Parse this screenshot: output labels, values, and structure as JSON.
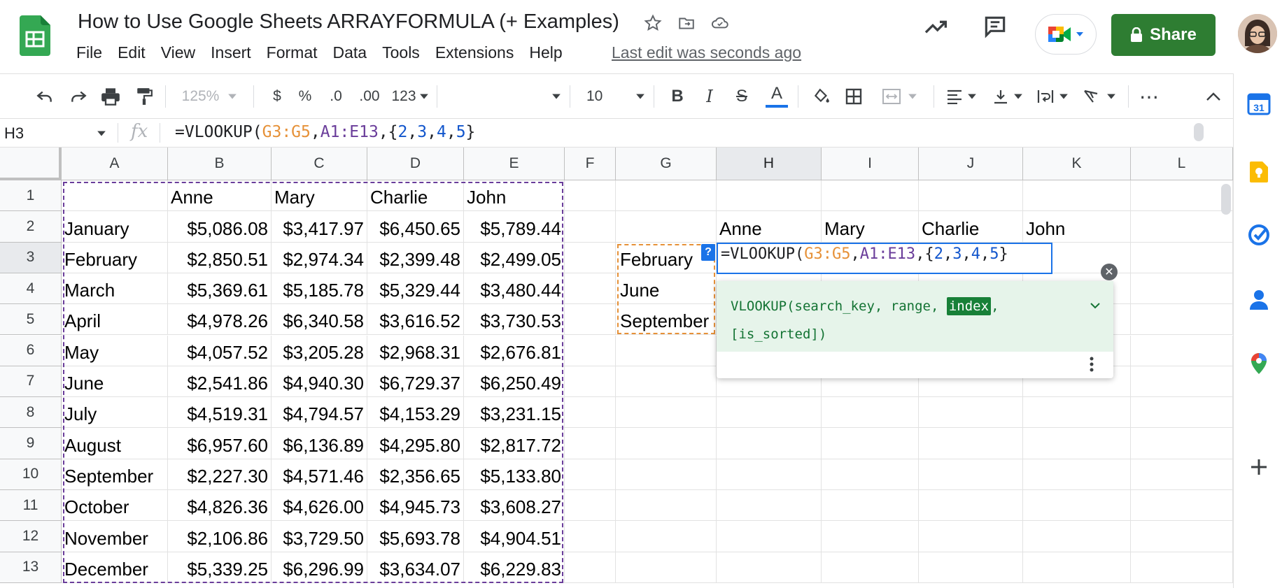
{
  "doc": {
    "title": "How to Use Google Sheets ARRAYFORMULA (+ Examples)",
    "last_edit": "Last edit was seconds ago"
  },
  "menu": [
    "File",
    "Edit",
    "View",
    "Insert",
    "Format",
    "Data",
    "Tools",
    "Extensions",
    "Help"
  ],
  "share_label": "Share",
  "toolbar": {
    "zoom": "125%",
    "currency": "$",
    "percent": "%",
    "dec_decrease": ".0",
    "dec_increase": ".00",
    "format": "123",
    "font_size": "10",
    "bold": "B",
    "italic": "I",
    "strike": "S",
    "text_color": "A",
    "more": "⋯"
  },
  "formula_bar": {
    "name_box": "H3",
    "fx": "fx",
    "formula_parts": [
      {
        "text": "=VLOOKUP(",
        "color": "#202124"
      },
      {
        "text": "G3:G5",
        "color": "#e69138"
      },
      {
        "text": ",",
        "color": "#202124"
      },
      {
        "text": "A1:E13",
        "color": "#6a3d9a"
      },
      {
        "text": ",{",
        "color": "#202124"
      },
      {
        "text": "2",
        "color": "#1155cc"
      },
      {
        "text": ",",
        "color": "#202124"
      },
      {
        "text": "3",
        "color": "#1155cc"
      },
      {
        "text": ",",
        "color": "#202124"
      },
      {
        "text": "4",
        "color": "#1155cc"
      },
      {
        "text": ",",
        "color": "#202124"
      },
      {
        "text": "5",
        "color": "#1155cc"
      },
      {
        "text": "}",
        "color": "#202124"
      }
    ]
  },
  "columns": [
    "A",
    "B",
    "C",
    "D",
    "E",
    "F",
    "G",
    "H",
    "I",
    "J",
    "K",
    "L"
  ],
  "selected_column": "H",
  "selected_row": 3,
  "rows": [
    "1",
    "2",
    "3",
    "4",
    "5",
    "6",
    "7",
    "8",
    "9",
    "10",
    "11",
    "12",
    "13"
  ],
  "table": {
    "header": [
      "",
      "Anne",
      "Mary",
      "Charlie",
      "John"
    ],
    "data": [
      [
        "January",
        "$5,086.08",
        "$3,417.97",
        "$6,450.65",
        "$5,789.44"
      ],
      [
        "February",
        "$2,850.51",
        "$2,974.34",
        "$2,399.48",
        "$2,499.05"
      ],
      [
        "March",
        "$5,369.61",
        "$5,185.78",
        "$5,329.44",
        "$3,480.44"
      ],
      [
        "April",
        "$4,978.26",
        "$6,340.58",
        "$3,616.52",
        "$3,730.53"
      ],
      [
        "May",
        "$4,057.52",
        "$3,205.28",
        "$2,968.31",
        "$2,676.81"
      ],
      [
        "June",
        "$2,541.86",
        "$4,940.30",
        "$6,729.37",
        "$6,250.49"
      ],
      [
        "July",
        "$4,519.31",
        "$4,794.57",
        "$4,153.29",
        "$3,231.15"
      ],
      [
        "August",
        "$6,957.60",
        "$6,136.89",
        "$4,295.80",
        "$2,817.72"
      ],
      [
        "September",
        "$2,227.30",
        "$4,571.46",
        "$2,356.65",
        "$5,133.80"
      ],
      [
        "October",
        "$4,826.36",
        "$4,626.00",
        "$4,945.73",
        "$3,608.27"
      ],
      [
        "November",
        "$2,106.86",
        "$3,729.50",
        "$5,693.78",
        "$4,904.51"
      ],
      [
        "December",
        "$5,339.25",
        "$6,296.99",
        "$3,634.07",
        "$6,229.83"
      ]
    ]
  },
  "lookup": {
    "names": [
      "Anne",
      "Mary",
      "Charlie",
      "John"
    ],
    "months": [
      "February",
      "June",
      "September"
    ]
  },
  "tooltip": {
    "fn": "VLOOKUP(",
    "args_before": "search_key, range, ",
    "highlight": "index",
    "after": ",",
    "line2": "[is_sorted])"
  },
  "qmark": "?",
  "colors": {
    "range_g": "#e69138",
    "range_a": "#6a3d9a",
    "const": "#1155cc",
    "share": "#2e7d32",
    "active": "#1a73e8"
  }
}
